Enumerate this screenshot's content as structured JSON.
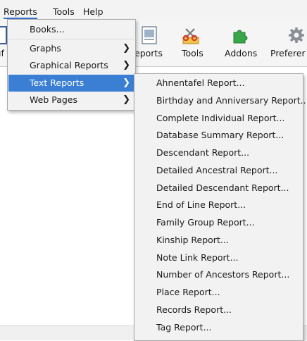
{
  "menubar": {
    "items": [
      {
        "label": "Reports"
      },
      {
        "label": "Tools"
      },
      {
        "label": "Help"
      }
    ]
  },
  "toolbar": {
    "left_partial_label": "ıf",
    "buttons": [
      {
        "label": "eports",
        "icon": "report-doc-icon"
      },
      {
        "label": "Tools",
        "icon": "scissors-tool-icon"
      },
      {
        "label": "Addons",
        "icon": "puzzle-piece-icon"
      },
      {
        "label": "Preferer",
        "icon": "gear-icon"
      }
    ]
  },
  "reports_menu": {
    "items": [
      {
        "label": "Books...",
        "has_submenu": false
      },
      {
        "label": "Graphs",
        "has_submenu": true
      },
      {
        "label": "Graphical Reports",
        "has_submenu": true
      },
      {
        "label": "Text Reports",
        "has_submenu": true,
        "selected": true
      },
      {
        "label": "Web Pages",
        "has_submenu": true
      }
    ],
    "submenu_arrow": "❯"
  },
  "text_reports_submenu": {
    "items": [
      {
        "label": "Ahnentafel Report..."
      },
      {
        "label": "Birthday and Anniversary Report..."
      },
      {
        "label": "Complete Individual Report..."
      },
      {
        "label": "Database Summary Report..."
      },
      {
        "label": "Descendant Report..."
      },
      {
        "label": "Detailed Ancestral Report..."
      },
      {
        "label": "Detailed Descendant Report..."
      },
      {
        "label": "End of Line Report..."
      },
      {
        "label": "Family Group Report..."
      },
      {
        "label": "Kinship Report..."
      },
      {
        "label": "Note Link Report..."
      },
      {
        "label": "Number of Ancestors Report..."
      },
      {
        "label": "Place Report..."
      },
      {
        "label": "Records Report..."
      },
      {
        "label": "Tag Report..."
      }
    ]
  },
  "colors": {
    "selection": "#3a7fd4",
    "menu_bg": "#f2f2f2",
    "active_menu_underline": "#3a70c8"
  }
}
